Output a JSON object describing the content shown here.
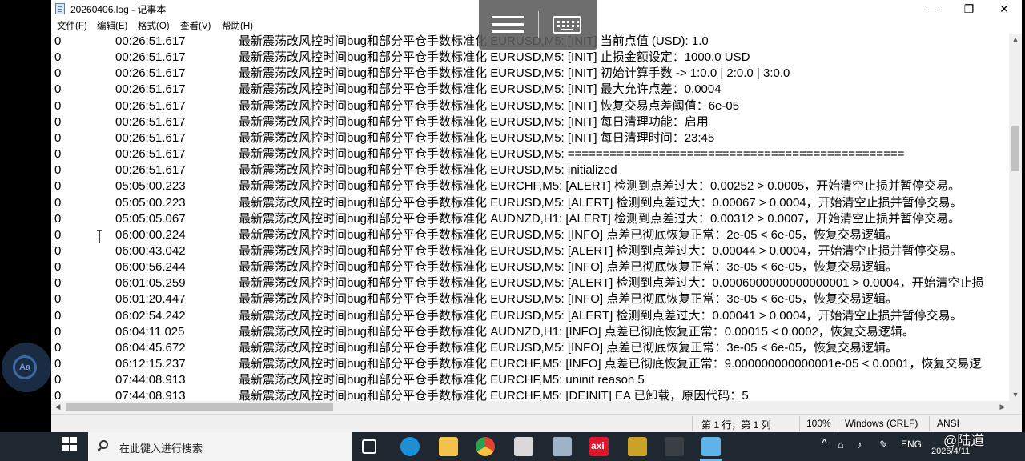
{
  "window": {
    "title": "20260406.log - 记事本",
    "minimize_glyph": "—",
    "maximize_glyph": "❐",
    "close_glyph": "✕"
  },
  "menu": [
    "文件(F)",
    "编辑(E)",
    "格式(O)",
    "查看(V)",
    "帮助(H)"
  ],
  "log_rows": [
    {
      "num": "0",
      "time": "00:26:51.617",
      "msg": "最新震荡改风控时间bug和部分平仓手数标准化 EURUSD,M5: [INIT] 当前点值 (USD): 1.0"
    },
    {
      "num": "0",
      "time": "00:26:51.617",
      "msg": "最新震荡改风控时间bug和部分平仓手数标准化 EURUSD,M5: [INIT] 止损金额设定：1000.0 USD"
    },
    {
      "num": "0",
      "time": "00:26:51.617",
      "msg": "最新震荡改风控时间bug和部分平仓手数标准化 EURUSD,M5: [INIT] 初始计算手数 -> 1:0.0 | 2:0.0 | 3:0.0"
    },
    {
      "num": "0",
      "time": "00:26:51.617",
      "msg": "最新震荡改风控时间bug和部分平仓手数标准化 EURUSD,M5: [INIT] 最大允许点差：0.0004"
    },
    {
      "num": "0",
      "time": "00:26:51.617",
      "msg": "最新震荡改风控时间bug和部分平仓手数标准化 EURUSD,M5: [INIT] 恢复交易点差阈值：6e-05"
    },
    {
      "num": "0",
      "time": "00:26:51.617",
      "msg": "最新震荡改风控时间bug和部分平仓手数标准化 EURUSD,M5: [INIT] 每日清理功能：启用"
    },
    {
      "num": "0",
      "time": "00:26:51.617",
      "msg": "最新震荡改风控时间bug和部分平仓手数标准化 EURUSD,M5: [INIT] 每日清理时间：23:45"
    },
    {
      "num": "0",
      "time": "00:26:51.617",
      "msg": "最新震荡改风控时间bug和部分平仓手数标准化 EURUSD,M5: ================================================"
    },
    {
      "num": "0",
      "time": "00:26:51.617",
      "msg": "最新震荡改风控时间bug和部分平仓手数标准化 EURUSD,M5: initialized"
    },
    {
      "num": "0",
      "time": "05:05:00.223",
      "msg": "最新震荡改风控时间bug和部分平仓手数标准化 EURCHF,M5: [ALERT] 检测到点差过大：0.00252 > 0.0005，开始清空止损并暂停交易。"
    },
    {
      "num": "0",
      "time": "05:05:00.223",
      "msg": "最新震荡改风控时间bug和部分平仓手数标准化 EURUSD,M5: [ALERT] 检测到点差过大：0.00067 > 0.0004，开始清空止损并暂停交易。"
    },
    {
      "num": "0",
      "time": "05:05:05.067",
      "msg": "最新震荡改风控时间bug和部分平仓手数标准化 AUDNZD,H1: [ALERT] 检测到点差过大：0.00312 > 0.0007，开始清空止损并暂停交易。"
    },
    {
      "num": "0",
      "time": "06:00:00.224",
      "msg": "最新震荡改风控时间bug和部分平仓手数标准化 EURUSD,M5: [INFO] 点差已彻底恢复正常：2e-05 < 6e-05，恢复交易逻辑。"
    },
    {
      "num": "0",
      "time": "06:00:43.042",
      "msg": "最新震荡改风控时间bug和部分平仓手数标准化 EURUSD,M5: [ALERT] 检测到点差过大：0.00044 > 0.0004，开始清空止损并暂停交易。"
    },
    {
      "num": "0",
      "time": "06:00:56.244",
      "msg": "最新震荡改风控时间bug和部分平仓手数标准化 EURUSD,M5: [INFO] 点差已彻底恢复正常：3e-05 < 6e-05，恢复交易逻辑。"
    },
    {
      "num": "0",
      "time": "06:01:05.259",
      "msg": "最新震荡改风控时间bug和部分平仓手数标准化 EURUSD,M5: [ALERT] 检测到点差过大：0.0006000000000000001 > 0.0004，开始清空止损"
    },
    {
      "num": "0",
      "time": "06:01:20.447",
      "msg": "最新震荡改风控时间bug和部分平仓手数标准化 EURUSD,M5: [INFO] 点差已彻底恢复正常：3e-05 < 6e-05，恢复交易逻辑。"
    },
    {
      "num": "0",
      "time": "06:02:54.242",
      "msg": "最新震荡改风控时间bug和部分平仓手数标准化 EURUSD,M5: [ALERT] 检测到点差过大：0.00041 > 0.0004，开始清空止损并暂停交易。"
    },
    {
      "num": "0",
      "time": "06:04:11.025",
      "msg": "最新震荡改风控时间bug和部分平仓手数标准化 AUDNZD,H1: [INFO] 点差已彻底恢复正常：0.00015 < 0.0002，恢复交易逻辑。"
    },
    {
      "num": "0",
      "time": "06:04:45.672",
      "msg": "最新震荡改风控时间bug和部分平仓手数标准化 EURUSD,M5: [INFO] 点差已彻底恢复正常：3e-05 < 6e-05，恢复交易逻辑。"
    },
    {
      "num": "0",
      "time": "06:12:15.237",
      "msg": "最新震荡改风控时间bug和部分平仓手数标准化 EURCHF,M5: [INFO] 点差已彻底恢复正常：9.000000000000001e-05 < 0.0001，恢复交易逻"
    },
    {
      "num": "0",
      "time": "07:44:08.913",
      "msg": "最新震荡改风控时间bug和部分平仓手数标准化 EURCHF,M5: uninit reason 5"
    },
    {
      "num": "0",
      "time": "07:44:08.913",
      "msg": "最新震荡改风控时间bug和部分平仓手数标准化 EURCHF,M5: [DEINIT] EA 已卸载，原因代码：5"
    }
  ],
  "statusbar": {
    "position": "第 1 行，第 1 列",
    "zoom": "100%",
    "line_ending": "Windows (CRLF)",
    "encoding": "ANSI"
  },
  "overlay": {
    "aa_label": "Aa"
  },
  "taskbar": {
    "search_placeholder": "在此键入进行搜索",
    "apps": [
      {
        "name": "task-view-icon",
        "color": "#1f2730"
      },
      {
        "name": "edge-icon",
        "color": "#1e8fd6"
      },
      {
        "name": "file-explorer-icon",
        "color": "#f2c14e"
      },
      {
        "name": "chrome-icon",
        "color": "#e34133"
      },
      {
        "name": "paint-icon",
        "color": "#d9d9d9"
      },
      {
        "name": "remote-desktop-icon",
        "color": "#9fb3c8"
      },
      {
        "name": "axi-icon",
        "color": "#e0142a"
      },
      {
        "name": "metatrader-icon",
        "color": "#c9a227"
      },
      {
        "name": "terminal-icon",
        "color": "#3a3f46"
      },
      {
        "name": "notepad-icon",
        "color": "#5fb3e6"
      }
    ],
    "axi_label": "axi",
    "tray_chevron": "^",
    "input_method": "ENG",
    "date": "2026/4/11",
    "watermark": "@陆道"
  }
}
